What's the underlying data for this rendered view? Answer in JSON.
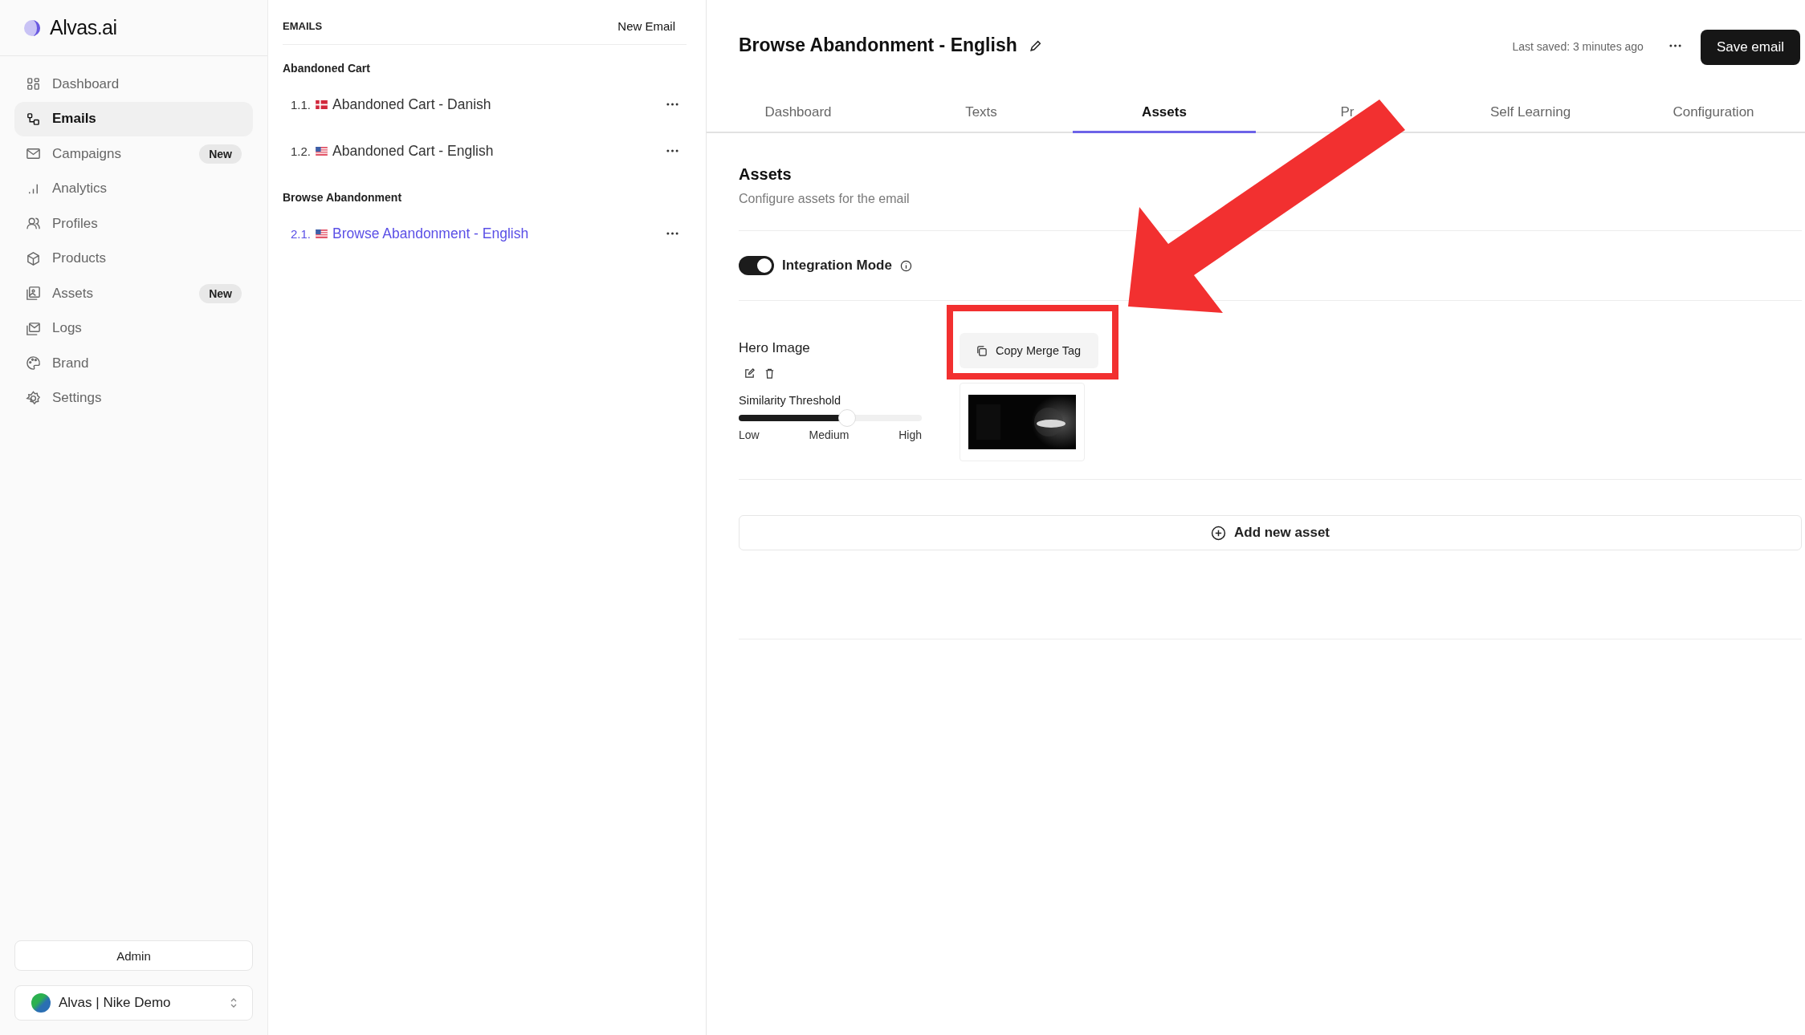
{
  "brand": {
    "name": "Alvas.ai"
  },
  "sidebar": {
    "items": [
      {
        "label": "Dashboard",
        "selected": false
      },
      {
        "label": "Emails",
        "selected": true
      },
      {
        "label": "Campaigns",
        "selected": false,
        "badge": "New"
      },
      {
        "label": "Analytics",
        "selected": false
      },
      {
        "label": "Profiles",
        "selected": false
      },
      {
        "label": "Products",
        "selected": false
      },
      {
        "label": "Assets",
        "selected": false,
        "badge": "New"
      },
      {
        "label": "Logs",
        "selected": false
      },
      {
        "label": "Brand",
        "selected": false
      },
      {
        "label": "Settings",
        "selected": false
      }
    ],
    "admin_button": "Admin",
    "workspace": "Alvas | Nike Demo"
  },
  "emails_panel": {
    "title": "EMAILS",
    "new_button": "New Email",
    "groups": [
      {
        "name": "Abandoned Cart",
        "items": [
          {
            "number": "1.1.",
            "kind": "dk",
            "label": "Abandoned Cart - Danish",
            "selected": false
          },
          {
            "number": "1.2.",
            "kind": "us",
            "label": "Abandoned Cart - English",
            "selected": false
          }
        ]
      },
      {
        "name": "Browse Abandonment",
        "items": [
          {
            "number": "2.1.",
            "kind": "us",
            "label": "Browse Abandonment - English",
            "selected": true
          }
        ]
      }
    ]
  },
  "editor": {
    "title": "Browse Abandonment - English",
    "last_saved": "Last saved: 3 minutes ago",
    "save_button": "Save email",
    "tabs": [
      {
        "label": "Dashboard",
        "selected": false
      },
      {
        "label": "Texts",
        "selected": false
      },
      {
        "label": "Assets",
        "selected": true
      },
      {
        "label": "Pr",
        "selected": false
      },
      {
        "label": "Self Learning",
        "selected": false
      },
      {
        "label": "Configuration",
        "selected": false
      }
    ],
    "section_title": "Assets",
    "section_subtitle": "Configure assets for the email",
    "integration_mode": {
      "label": "Integration Mode",
      "on": true
    },
    "assets": [
      {
        "name": "Hero Image",
        "slider_label": "Similarity Threshold",
        "level": 0.59,
        "scale": [
          "Low",
          "Medium",
          "High"
        ],
        "copy_button": "Copy Merge Tag",
        "kind": "picture"
      }
    ],
    "add_button": "Add new asset"
  }
}
